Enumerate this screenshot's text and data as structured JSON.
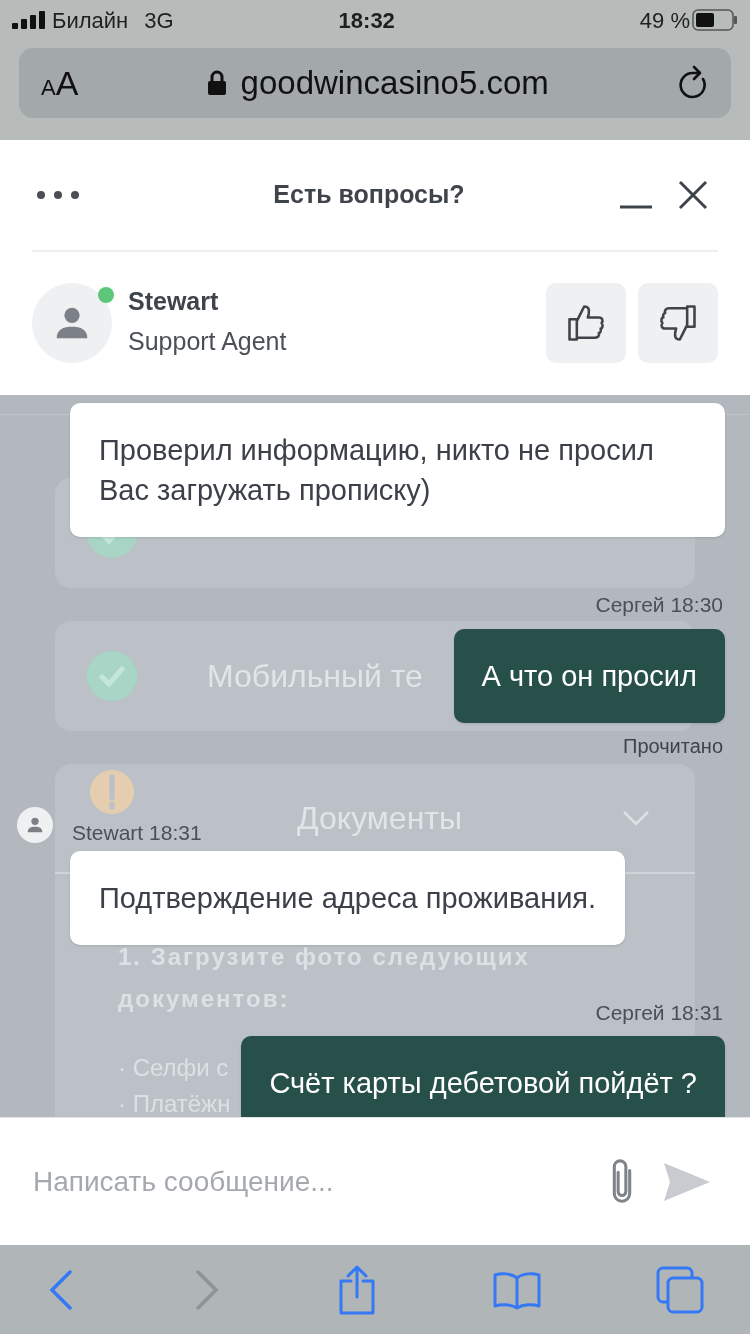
{
  "status_bar": {
    "carrier": "Билайн",
    "network": "3G",
    "time": "18:32",
    "battery": "49 %"
  },
  "browser": {
    "text_size_button": "AA",
    "url": "goodwincasino5.com"
  },
  "page": {
    "sections": [
      {
        "verified": true,
        "expandable": false
      },
      {
        "title": "Мобильный те",
        "verified": true,
        "expandable": false
      },
      {
        "title": "Документы",
        "verified": false,
        "expandable": true,
        "instruction": "1. Загрузите фото следующих документов:",
        "items": [
          "· Селфи с",
          "· Платёжн"
        ]
      }
    ]
  },
  "chat": {
    "title": "Есть вопросы?",
    "agent": {
      "name": "Stewart",
      "role": "Support Agent",
      "online": true
    },
    "messages": [
      {
        "kind": "incoming",
        "text": "Проверил информацию, никто не просил Вас загружать прописку)"
      },
      {
        "kind": "outgoing",
        "meta": "Сергей 18:30",
        "text": "А что он просил",
        "status": "Прочитано"
      },
      {
        "kind": "incoming",
        "meta": "Stewart 18:31",
        "text": "Подтверждение адреса проживания."
      },
      {
        "kind": "outgoing",
        "meta": "Сергей 18:31",
        "text": "Счёт карты дебетовой пойдёт ?"
      }
    ],
    "input": {
      "placeholder": "Написать сообщение..."
    }
  }
}
